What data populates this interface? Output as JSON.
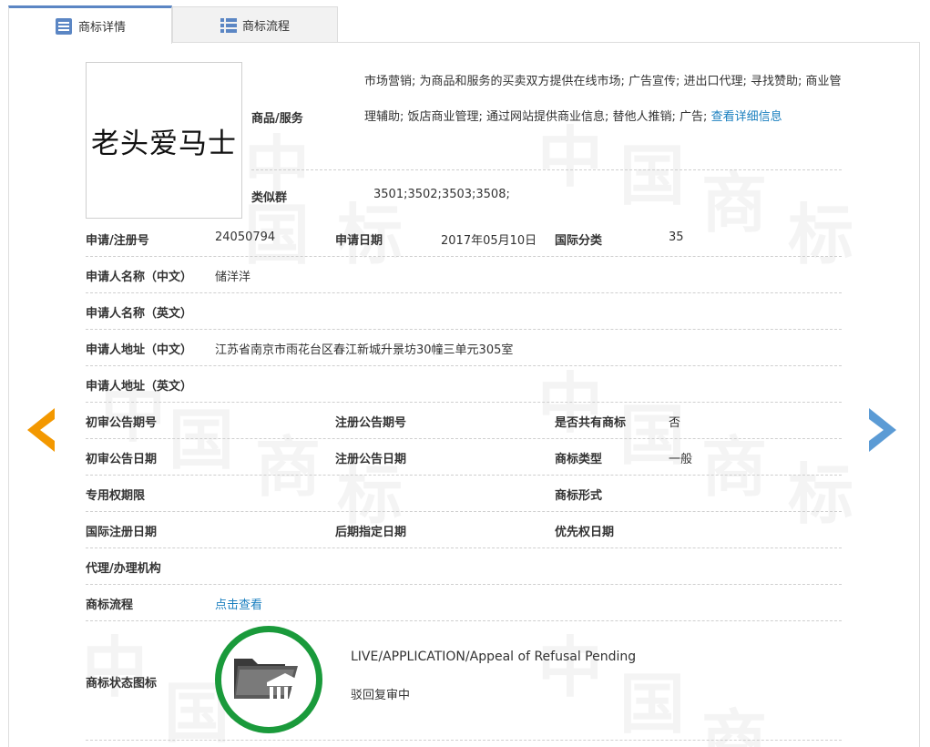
{
  "tabs": {
    "detail": "商标详情",
    "flow": "商标流程"
  },
  "logo": {
    "text": "老头爱马士"
  },
  "watermark": [
    "中",
    "国",
    "商",
    "标"
  ],
  "goods": {
    "label": "商品/服务",
    "text": "市场营销; 为商品和服务的买卖双方提供在线市场; 广告宣传; 进出口代理; 寻找赞助; 商业管理辅助; 饭店商业管理; 通过网站提供商业信息; 替他人推销; 广告; ",
    "more_link": "查看详细信息"
  },
  "similar": {
    "label": "类似群",
    "value": "3501;3502;3503;3508;"
  },
  "reg": {
    "number_label": "申请/注册号",
    "number": "24050794",
    "date_label": "申请日期",
    "date": "2017年05月10日",
    "class_label": "国际分类",
    "class": "35"
  },
  "applicant": {
    "name_cn_label": "申请人名称（中文）",
    "name_cn": "储洋洋",
    "name_en_label": "申请人名称（英文）",
    "name_en": "",
    "addr_cn_label": "申请人地址（中文）",
    "addr_cn": "江苏省南京市雨花台区春江新城升景坊30幢三单元305室",
    "addr_en_label": "申请人地址（英文）",
    "addr_en": ""
  },
  "pub": {
    "prelim_no_label": "初审公告期号",
    "prelim_no": "",
    "reg_no_label": "注册公告期号",
    "reg_no": "",
    "shared_label": "是否共有商标",
    "shared": "否",
    "prelim_date_label": "初审公告日期",
    "prelim_date": "",
    "reg_date_label": "注册公告日期",
    "reg_date": "",
    "type_label": "商标类型",
    "type": "一般"
  },
  "rights": {
    "period_label": "专用权期限",
    "period": "",
    "form_label": "商标形式",
    "form": ""
  },
  "intl": {
    "reg_date_label": "国际注册日期",
    "reg_date": "",
    "later_label": "后期指定日期",
    "later": "",
    "priority_label": "优先权日期",
    "priority": ""
  },
  "agent": {
    "label": "代理/办理机构",
    "value": ""
  },
  "flow": {
    "label": "商标流程",
    "link": "点击查看"
  },
  "status": {
    "label": "商标状态图标",
    "en": "LIVE/APPLICATION/Appeal of Refusal Pending",
    "cn": "驳回复审中",
    "ring_color": "#1a9a3b"
  },
  "colors": {
    "tab_accent": "#5b86c4",
    "link": "#1a7fbf",
    "prev_arrow": "#f39800",
    "next_arrow": "#5b9bd5"
  }
}
